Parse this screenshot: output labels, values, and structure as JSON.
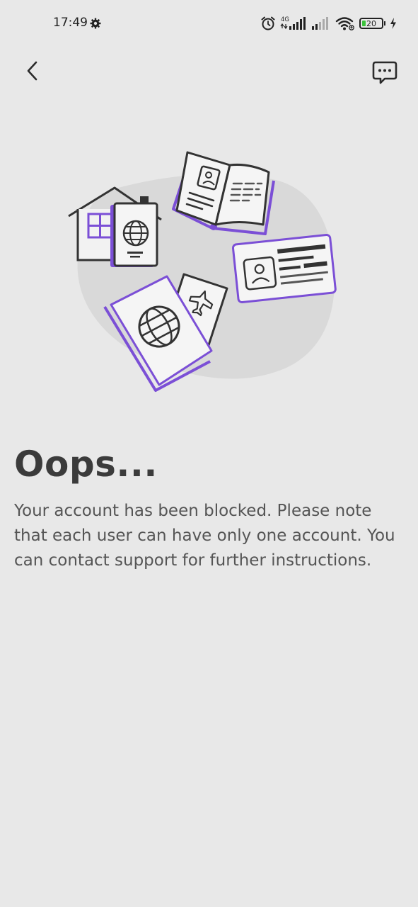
{
  "status_bar": {
    "time": "17:49",
    "network_label": "4G",
    "battery_level": "20",
    "icons": [
      "gear-icon",
      "alarm-icon",
      "cellular-signal-icon",
      "wifi-icon",
      "battery-icon",
      "charging-icon"
    ]
  },
  "header": {
    "back_icon": "chevron-left-icon",
    "support_icon": "chat-bubble-icon"
  },
  "illustration": {
    "icons": [
      "house-icon",
      "globe-icon",
      "open-book-icon",
      "id-card-icon",
      "passport-icon",
      "airplane-ticket-icon"
    ],
    "accent_color": "#7b4fd6",
    "blob_color": "#d9d9d9",
    "stroke_color": "#333333"
  },
  "content": {
    "title": "Oops...",
    "message": "Your account has been blocked. Please note that each user can have only one account. You can contact support for further instructions."
  },
  "colors": {
    "background": "#e8e8e8",
    "title_text": "#3b3b3b",
    "body_text": "#555555"
  }
}
